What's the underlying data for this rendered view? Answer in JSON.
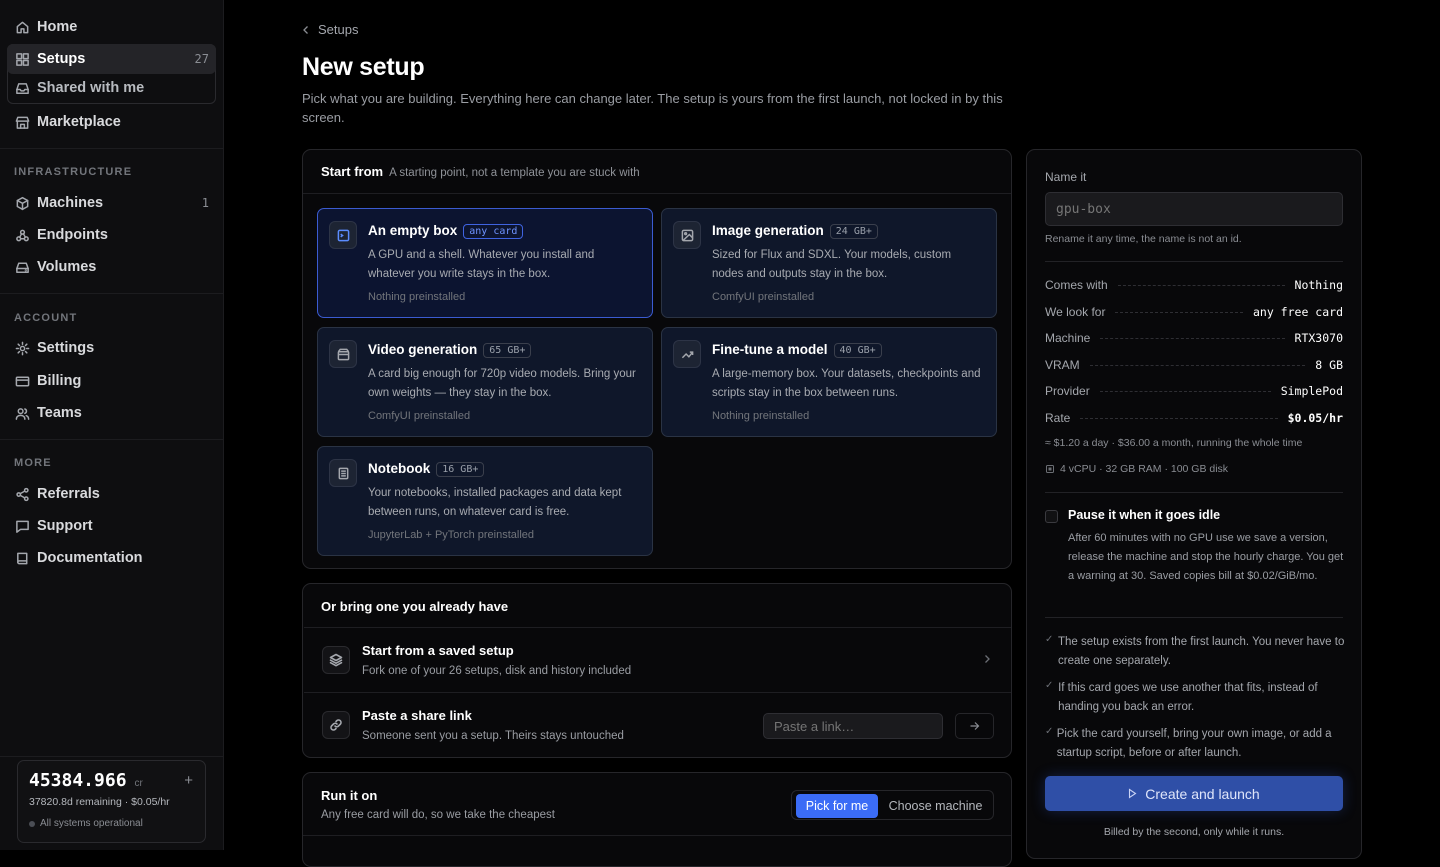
{
  "sidebar": {
    "nav_top": [
      {
        "label": "Home",
        "icon": "home-icon"
      },
      {
        "label": "Setups",
        "count": "27",
        "icon": "grid-icon",
        "active": true
      },
      {
        "label": "Shared with me",
        "icon": "inbox-icon"
      },
      {
        "label": "Marketplace",
        "icon": "store-icon"
      }
    ],
    "infrastructure": {
      "heading": "INFRASTRUCTURE",
      "items": [
        {
          "label": "Machines",
          "count": "1",
          "icon": "cube-icon"
        },
        {
          "label": "Endpoints",
          "icon": "webhook-icon"
        },
        {
          "label": "Volumes",
          "icon": "drive-icon"
        }
      ]
    },
    "account": {
      "heading": "ACCOUNT",
      "items": [
        {
          "label": "Settings",
          "icon": "gear-icon"
        },
        {
          "label": "Billing",
          "icon": "card-icon"
        },
        {
          "label": "Teams",
          "icon": "users-icon"
        }
      ]
    },
    "more": {
      "heading": "MORE",
      "items": [
        {
          "label": "Referrals",
          "icon": "share-icon"
        },
        {
          "label": "Support",
          "icon": "chat-icon"
        },
        {
          "label": "Documentation",
          "icon": "book-icon"
        }
      ]
    },
    "credits": {
      "amount": "45384.966",
      "unit": "cr",
      "remaining": "37820.8d remaining · $0.05/hr",
      "status": "All systems operational",
      "status_color": "#4b4e55"
    }
  },
  "breadcrumb": {
    "label": "Setups"
  },
  "page": {
    "title": "New setup",
    "subtitle": "Pick what you are building. Everything here can change later. The setup is yours from the first launch, not locked in by this screen."
  },
  "start_from": {
    "title": "Start from",
    "note": "A starting point, not a template you are stuck with",
    "cards": [
      {
        "title": "An empty box",
        "tag": "any card",
        "desc": "A GPU and a shell. Whatever you install and whatever you write stays in the box.",
        "foot": "Nothing preinstalled",
        "icon": "terminal-icon",
        "selected": true
      },
      {
        "title": "Image generation",
        "tag": "24 GB+",
        "desc": "Sized for Flux and SDXL. Your models, custom nodes and outputs stay in the box.",
        "foot": "ComfyUI preinstalled",
        "icon": "image-icon",
        "selected": false
      },
      {
        "title": "Video generation",
        "tag": "65 GB+",
        "desc": "A card big enough for 720p video models. Bring your own weights — they stay in the box.",
        "foot": "ComfyUI preinstalled",
        "icon": "film-icon",
        "selected": false
      },
      {
        "title": "Fine-tune a model",
        "tag": "40 GB+",
        "desc": "A large-memory box. Your datasets, checkpoints and scripts stay in the box between runs.",
        "foot": "Nothing preinstalled",
        "icon": "trend-icon",
        "selected": false
      },
      {
        "title": "Notebook",
        "tag": "16 GB+",
        "desc": "Your notebooks, installed packages and data kept between runs, on whatever card is free.",
        "foot": "JupyterLab + PyTorch preinstalled",
        "icon": "notebook-icon",
        "selected": false
      }
    ]
  },
  "bring": {
    "title": "Or bring one you already have",
    "saved": {
      "title": "Start from a saved setup",
      "desc": "Fork one of your 26 setups, disk and history included"
    },
    "share": {
      "title": "Paste a share link",
      "desc": "Someone sent you a setup. Theirs stays untouched",
      "placeholder": "Paste a link…"
    }
  },
  "run_on": {
    "title": "Run it on",
    "desc": "Any free card will do, so we take the cheapest",
    "options": [
      "Pick for me",
      "Choose machine"
    ],
    "selected": "Pick for me"
  },
  "summary": {
    "name_label": "Name it",
    "name_placeholder": "gpu-box",
    "name_hint": "Rename it any time, the name is not an id.",
    "rows": [
      {
        "k": "Comes with",
        "v": "Nothing"
      },
      {
        "k": "We look for",
        "v": "any free card"
      },
      {
        "k": "Machine",
        "v": "RTX3070"
      },
      {
        "k": "VRAM",
        "v": "8 GB"
      },
      {
        "k": "Provider",
        "v": "SimplePod"
      },
      {
        "k": "Rate",
        "v": "$0.05/hr"
      }
    ],
    "cost_note": "≈ $1.20 a day · $36.00 a month, running the whole time",
    "specs": "4 vCPU · 32 GB RAM · 100 GB disk",
    "pause_title": "Pause it when it goes idle",
    "pause_desc": "After 60 minutes with no GPU use we save a version, release the machine and stop the hourly charge. You get a warning at 30. Saved copies bill at $0.02/GiB/mo.",
    "checks": [
      "The setup exists from the first launch. You never have to create one separately.",
      "If this card goes we use another that fits, instead of handing you back an error.",
      "Pick the card yourself, bring your own image, or add a startup script, before or after launch."
    ],
    "launch_label": "Create and launch",
    "billing_note": "Billed by the second, only while it runs."
  },
  "colors": {
    "accent": "#3b6cf6",
    "button": "#2f4fa7",
    "background": "#000000",
    "card": "#0f172a"
  }
}
